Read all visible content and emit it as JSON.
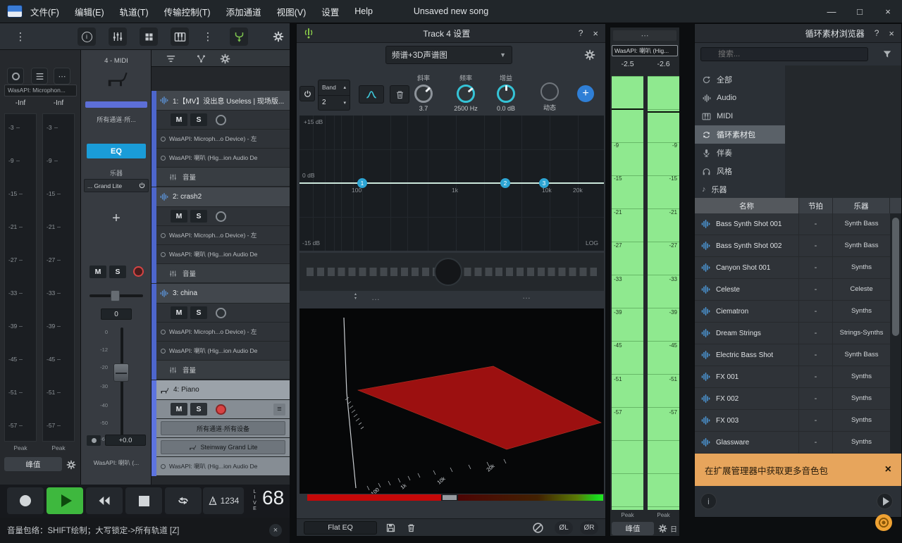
{
  "glyphs": {
    "kebab": "⋮",
    "ellipsis": "⋯",
    "dots": "…",
    "caret_down": "▾",
    "caret_up": "▴",
    "dropdown": "▼",
    "menu": "≡",
    "note": "♪",
    "minimize": "—",
    "maximize": "□",
    "close": "×",
    "help": "?",
    "plus": "+",
    "info": "i"
  },
  "colors": {
    "accent_blue": "#2f7fd6",
    "eq_button_blue": "#1a9cd8",
    "teal": "#35c3d6",
    "meter_green": "#8fe98f",
    "play_green": "#3eb83e",
    "notification_orange": "#e7a55c",
    "track_color": "#4d66cc",
    "plane_red": "#9c1010"
  },
  "menubar": {
    "menus": [
      "文件(F)",
      "编辑(E)",
      "轨道(T)",
      "传输控制(T)",
      "添加通道",
      "视图(V)",
      "设置",
      "Help"
    ],
    "title": "Unsaved new song"
  },
  "master_meter": {
    "device": "WasAPI: Microphon...",
    "readout_left": "-Inf",
    "readout_right": "-Inf",
    "scale": [
      "-3",
      "-9",
      "-15",
      "-21",
      "-27",
      "-33",
      "-39",
      "-45",
      "-51",
      "-57"
    ],
    "peak_label": "Peak",
    "mode_button": "峰值"
  },
  "track_panel": {
    "title": "4 - MIDI",
    "routing": "所有通道·所...",
    "eq_button": "EQ",
    "instrument_section": "乐器",
    "instrument": "... Grand Lite",
    "mute": "M",
    "solo": "S",
    "pan_value": "0",
    "fader_scale": [
      "0",
      "-12",
      "-20",
      "-30",
      "-40",
      "-50",
      "-60"
    ],
    "gain_value": "+0.0",
    "output_device": "WasAPI: 喇叭 (..."
  },
  "tracklist": {
    "tracks": [
      {
        "name": "1:【MV】没出息 Useless | 现场版...",
        "mute": "M",
        "solo": "S",
        "input_1": "WasAPI: Microph...o Device) - 左",
        "input_2": "WasAPI: 喇叭 (Hig...ion Audio De",
        "volume_label": "音量"
      },
      {
        "name": "2: crash2",
        "mute": "M",
        "solo": "S",
        "input_1": "WasAPI: Microph...o Device) - 左",
        "input_2": "WasAPI: 喇叭 (Hig...ion Audio De",
        "volume_label": "音量"
      },
      {
        "name": "3: china",
        "mute": "M",
        "solo": "S",
        "input_1": "WasAPI: Microph...o Device) - 左",
        "input_2": "WasAPI: 喇叭 (Hig...ion Audio De",
        "volume_label": "音量"
      },
      {
        "name": "4: Piano",
        "mute": "M",
        "solo": "S",
        "channels": "所有通道·所有设备",
        "instrument": "Steinway Grand Lite",
        "output": "WasAPI: 喇叭 (Hig...ion Audio De"
      }
    ]
  },
  "transport": {
    "counter": "1234",
    "live": "LIVE",
    "tempo": "68"
  },
  "statusbar": {
    "text": "音量包络：SHIFT绘制；大写锁定->所有轨道 [Z]"
  },
  "eq": {
    "title": "Track 4 设置",
    "view_selector": "频谱+3D声谱图",
    "band_label": "Band",
    "band_value": "2",
    "slope_label": "斜率",
    "slope_value": "3.7",
    "freq_label": "频率",
    "freq_value": "2500 Hz",
    "gain_label": "增益",
    "gain_value": "0.0 dB",
    "dynamics_label": "动态",
    "graph": {
      "db_top": "+15 dB",
      "db_mid": "0 dB",
      "db_bottom": "-15 dB",
      "f_100": "100",
      "f_1k": "1k",
      "f_10k": "10k",
      "f_20k": "20k",
      "scale_mode": "LOG",
      "point_1": "1",
      "point_2": "2",
      "point_3": "3"
    },
    "preset": "Flat EQ",
    "phase_left": "ØL",
    "phase_right": "ØR"
  },
  "out_meter": {
    "device": "WasAPI: 喇叭 (Hig...",
    "readout_left": "-2.5",
    "readout_right": "-2.6",
    "scale": [
      "-9",
      "-15",
      "-21",
      "-27",
      "-33",
      "-39",
      "-45",
      "-51",
      "-57"
    ],
    "peak_label": "Peak",
    "mode_button": "峰值",
    "style_button": "日"
  },
  "browser": {
    "title": "循环素材浏览器",
    "search_placeholder": "搜索...",
    "categories": [
      {
        "label": "全部"
      },
      {
        "label": "Audio"
      },
      {
        "label": "MIDI"
      },
      {
        "label": "循环素材包"
      },
      {
        "label": "伴奏"
      },
      {
        "label": "风格"
      },
      {
        "label": "乐器"
      }
    ],
    "columns": {
      "name": "名称",
      "beat": "节拍",
      "instrument": "乐器"
    },
    "rows": [
      {
        "name": "Bass Synth Shot 001",
        "beat": "-",
        "instrument": "Synth Bass"
      },
      {
        "name": "Bass Synth Shot 002",
        "beat": "-",
        "instrument": "Synth Bass"
      },
      {
        "name": "Canyon Shot 001",
        "beat": "-",
        "instrument": "Synths"
      },
      {
        "name": "Celeste",
        "beat": "-",
        "instrument": "Celeste"
      },
      {
        "name": "Ciematron",
        "beat": "-",
        "instrument": "Synths"
      },
      {
        "name": "Dream Strings",
        "beat": "-",
        "instrument": "Strings-Synths"
      },
      {
        "name": "Electric Bass Shot",
        "beat": "-",
        "instrument": "Synth Bass"
      },
      {
        "name": "FX 001",
        "beat": "-",
        "instrument": "Synths"
      },
      {
        "name": "FX 002",
        "beat": "-",
        "instrument": "Synths"
      },
      {
        "name": "FX 003",
        "beat": "-",
        "instrument": "Synths"
      },
      {
        "name": "Glassware",
        "beat": "-",
        "instrument": "Synths"
      }
    ],
    "notification": "在扩展管理器中获取更多音色包"
  }
}
